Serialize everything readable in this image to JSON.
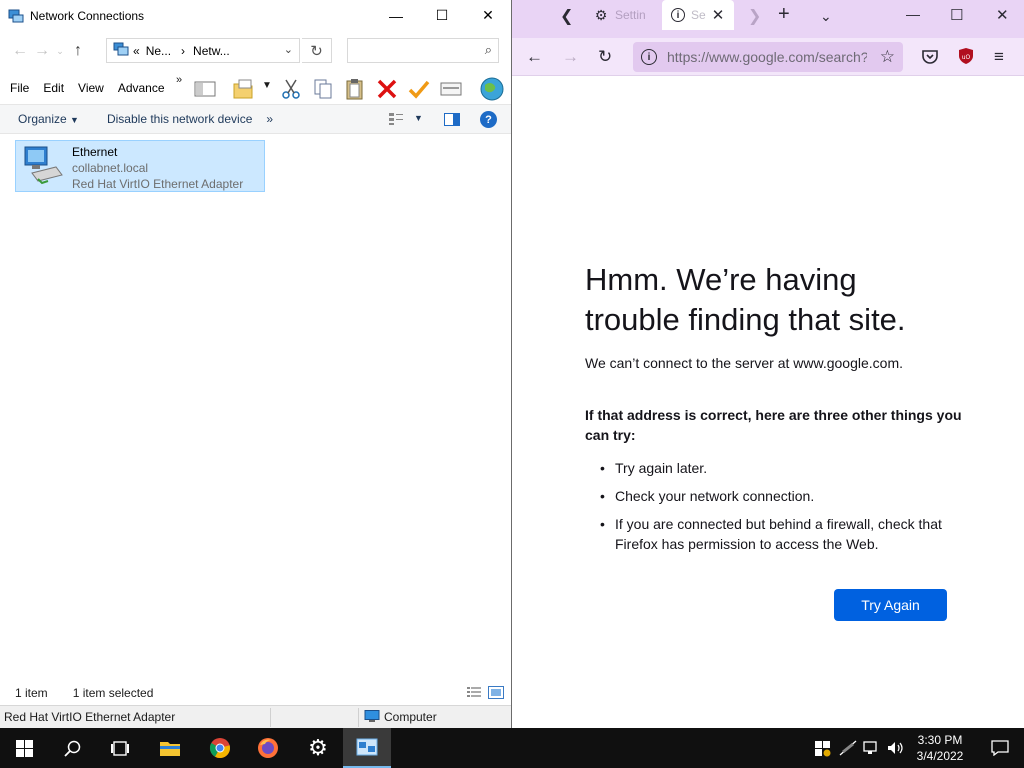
{
  "explorer": {
    "title": "Network Connections",
    "address": {
      "overflow": "«",
      "seg1": "Ne...",
      "sep": "›",
      "seg2": "Netw..."
    },
    "menu": [
      "File",
      "Edit",
      "View",
      "Advance"
    ],
    "menu_more": "»",
    "commands": {
      "organize": "Organize",
      "disable": "Disable this network device",
      "more": "»"
    },
    "item": {
      "name": "Ethernet",
      "domain": "collabnet.local",
      "adapter": "Red Hat VirtIO Ethernet Adapter"
    },
    "status": {
      "count": "1 item",
      "selected": "1 item selected"
    },
    "bottom": {
      "adapter": "Red Hat VirtIO Ethernet Adapter",
      "zone": "Computer"
    }
  },
  "firefox": {
    "tabs": [
      {
        "label": "Settin",
        "icon": "gear-icon"
      },
      {
        "label": "Se",
        "icon": "info-icon"
      }
    ],
    "url": "https://www.google.com/search?client=firefox",
    "error": {
      "title": "Hmm. We’re having trouble finding that site.",
      "desc": "We can’t connect to the server at www.google.com.",
      "subtitle": "If that address is correct, here are three other things you can try:",
      "tips": [
        "Try again later.",
        "Check your network connection.",
        "If you are connected but behind a firewall, check that Firefox has permission to access the Web."
      ],
      "button": "Try Again"
    },
    "accent": "#0061e0",
    "theme": "#e9d4f5"
  },
  "taskbar": {
    "time": "3:30 PM",
    "date": "3/4/2022"
  }
}
